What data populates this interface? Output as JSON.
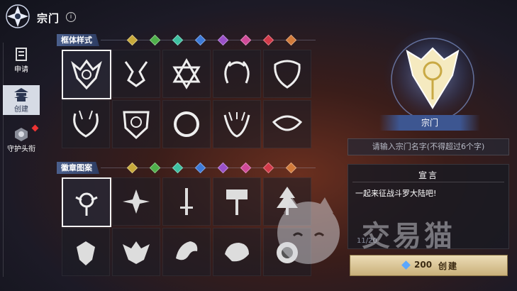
{
  "header": {
    "title": "宗门",
    "info_icon": "info-icon"
  },
  "sidebar": {
    "items": [
      {
        "label": "申请",
        "icon": "apply-icon",
        "active": false
      },
      {
        "label": "创建",
        "icon": "create-pagoda-icon",
        "active": true
      },
      {
        "label": "守护头衔",
        "icon": "guardian-icon",
        "active": false,
        "badge": true
      }
    ]
  },
  "frame_section": {
    "label": "框体样式",
    "color_swatches": [
      "#c8a93a",
      "#4fb04a",
      "#3ec0a0",
      "#3d7ad8",
      "#9a50c8",
      "#d04a98",
      "#d23a4a",
      "#d27a3a"
    ],
    "styles": [
      "frame-1",
      "frame-2",
      "frame-3",
      "frame-4",
      "frame-5",
      "frame-6",
      "frame-7",
      "frame-8",
      "frame-9",
      "frame-10"
    ],
    "selected": 0
  },
  "emblem_section": {
    "label": "徽章图案",
    "color_swatches": [
      "#c8a93a",
      "#4fb04a",
      "#3ec0a0",
      "#3d7ad8",
      "#9a50c8",
      "#d04a98",
      "#d23a4a",
      "#d27a3a"
    ],
    "patterns": [
      "orb-emblem",
      "star-emblem",
      "sword-emblem",
      "hammer-emblem",
      "tree-emblem",
      "wing-emblem",
      "bat-emblem",
      "dragon-emblem",
      "tiger-emblem",
      "lion-emblem"
    ],
    "selected": 0
  },
  "preview": {
    "name_plate": "宗门"
  },
  "name_input": {
    "placeholder": "请输入宗门名字(不得超过6个字)"
  },
  "declaration": {
    "title": "宣言",
    "text": "一起来征战斗罗大陆吧!",
    "count": "11/20"
  },
  "create_button": {
    "cost": "200",
    "label": "创建"
  },
  "watermark": {
    "text": "交易猫"
  }
}
